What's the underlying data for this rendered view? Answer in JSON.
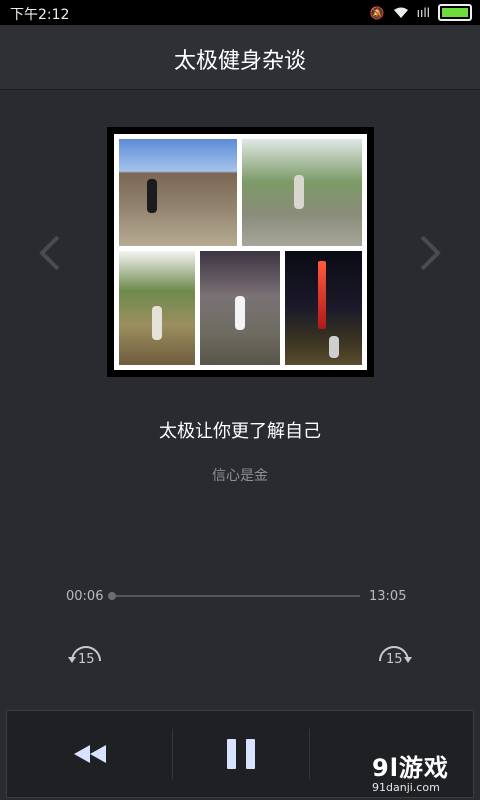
{
  "status_bar": {
    "time": "下午2:12",
    "signal_text": "ııll"
  },
  "header": {
    "title": "太极健身杂谈"
  },
  "track": {
    "title": "太极让你更了解自己",
    "subtitle": "信心是金"
  },
  "player": {
    "current_time": "00:06",
    "total_time": "13:05",
    "progress": 0.0077,
    "skip_back_label": "15",
    "skip_forward_label": "15"
  },
  "watermark": {
    "logo": "9l游戏",
    "site": "91danji.com"
  },
  "colors": {
    "background": "#2a2b30",
    "header": "#2f3035",
    "control_bar": "#1f2023",
    "pause_icon": "#d7e3ff",
    "battery": "#6ddc3c"
  },
  "icons": [
    "chevron-left-icon",
    "chevron-right-icon",
    "rewind-15-icon",
    "forward-15-icon",
    "previous-icon",
    "pause-icon",
    "wifi-icon",
    "mute-icon",
    "battery-icon"
  ]
}
